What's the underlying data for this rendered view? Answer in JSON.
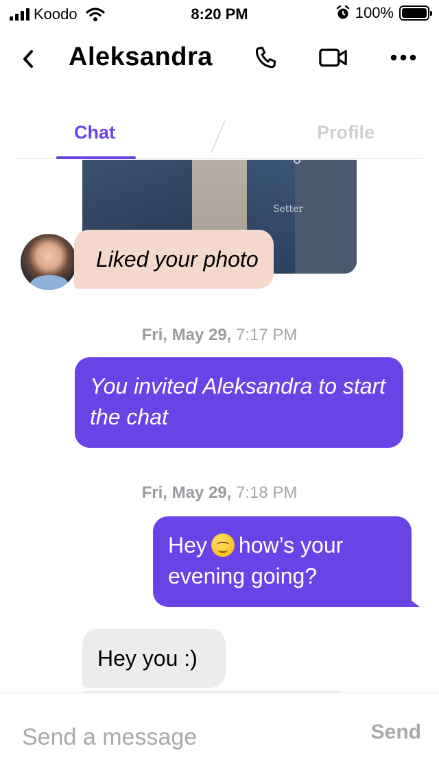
{
  "status_bar": {
    "carrier": "Koodo",
    "time": "8:20 PM",
    "battery": "100%",
    "icons": [
      "signal-icon",
      "wifi-icon",
      "alarm-icon",
      "battery-icon"
    ]
  },
  "header": {
    "title": "Aleksandra",
    "icons": [
      "back-chevron-icon",
      "phone-icon",
      "video-camera-icon",
      "more-dots-icon"
    ]
  },
  "tabs": {
    "chat": "Chat",
    "profile": "Profile",
    "active": "Chat"
  },
  "messages": [
    {
      "from": "them",
      "text": "Liked your photo"
    },
    {
      "timestamp_day": "Fri, May 29,",
      "timestamp_time": "7:17 PM"
    },
    {
      "from": "me",
      "text": "You invited Aleksandra to start the chat"
    },
    {
      "timestamp_day": "Fri, May 29,",
      "timestamp_time": "7:18 PM"
    },
    {
      "from": "me",
      "text_before": "Hey",
      "emoji": "smiling-face-emoji",
      "text_after": "how’s your evening going?"
    },
    {
      "from": "them",
      "text": "Hey you :)"
    }
  ],
  "photo": {
    "logo_text": "Setter"
  },
  "composer": {
    "placeholder": "Send a message",
    "send_label": "Send"
  },
  "colors": {
    "accent": "#6a43e6",
    "liked_bubble": "#f5d8cc",
    "incoming_bubble": "#ececee",
    "muted_text": "#a9a9ad"
  }
}
